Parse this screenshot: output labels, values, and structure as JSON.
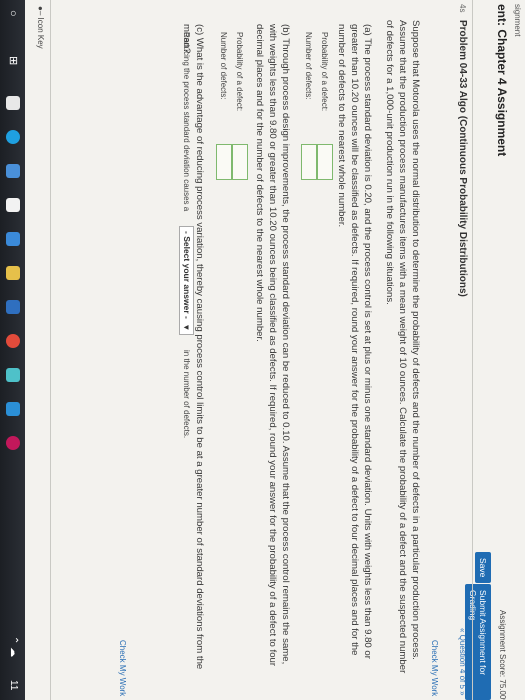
{
  "header": {
    "assignment_crumb": "signment",
    "assignment_title": "ent: Chapter 4 Assignment",
    "score": "Assignment Score: 75.00%",
    "save_label": "Save",
    "submit_label": "Submit Assignment for Grading"
  },
  "problem": {
    "prefix": "4s",
    "title": "Problem 04-33 Algo (Continuous Probability Distributions)",
    "question_nav": "« Question 4 of 5 »",
    "check_work_top": "Check My Work",
    "intro": "Suppose that Motorola uses the normal distribution to determine the probability of defects and the number of defects in a particular production process. Assume that the production process manufactures items with a mean weight of 10 ounces. Calculate the probability of a defect and the suspected number of defects for a 1,000-unit production run in the following situations.",
    "part_a": "(a) The process standard deviation is 0.20, and the process control is set at plus or minus one standard deviation. Units with weights less than 9.80 or greater than 10.20 ounces will be classified as defects. If required, round your answer for the probability of a defect to four decimal places and for the number of defects to the nearest whole number.",
    "part_a_prob_label": "Probability of a defect:",
    "part_a_num_label": "Number of defects:",
    "part_b": "(b) Through process design improvements, the process standard deviation can be reduced to 0.10. Assume that the process control remains the same, with weights less than 9.80 or greater than 10.20 ounces being classified as defects. If required, round your answer for the probability of a defect to four decimal places and for the number of defects to the nearest whole number.",
    "part_b_prob_label": "Probability of a defect:",
    "part_b_num_label": "Number of defects:",
    "part_c": "(c) What is the advantage of reducing process variation, thereby causing process control limits to be at a greater number of standard deviations from the mean?",
    "part_c_sentence_start": "Reducing the process standard deviation causes a",
    "part_c_select": "- Select your answer -",
    "part_c_sentence_end": "in the number of defects.",
    "check_work_bottom": "Check My Work",
    "icon_key": "Icon Key"
  },
  "taskbar": {
    "time_partial": "11"
  },
  "colors": {
    "link_blue": "#2a6fb5",
    "button_blue": "#1f6cb3",
    "input_border_green": "#7fb96e"
  }
}
